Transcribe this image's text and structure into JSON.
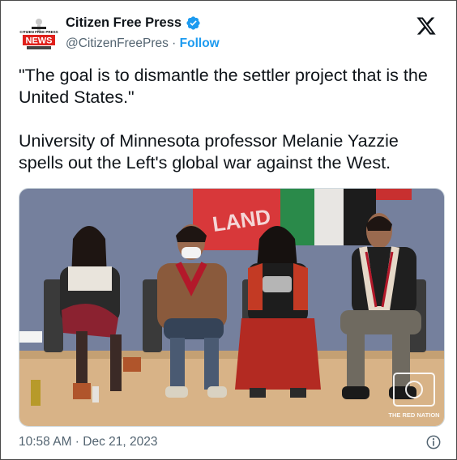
{
  "author": {
    "name": "Citizen Free Press",
    "handle": "@CitizenFreePres",
    "separator": "·",
    "follow_label": "Follow",
    "verified_color": "#1d9bf0"
  },
  "avatar": {
    "logo_top": "CITIZEN FREE PRESS",
    "logo_main": "NEWS"
  },
  "tweet": {
    "paragraph_1": "\"The goal is to dismantle the settler project that is the United States.\"",
    "paragraph_2": "University of Minnesota professor Melanie Yazzie spells out the Left's global war against the West."
  },
  "media": {
    "type": "video-still",
    "description_icons": [
      "panel-of-four-speakers"
    ],
    "watermark": "THE RED NATION",
    "banner_text": "LAND"
  },
  "footer": {
    "timestamp": "10:58 AM · Dec 21, 2023"
  },
  "icons": {
    "x_logo": "x-logo-icon",
    "info": "info-icon",
    "verified": "verified-badge-icon"
  }
}
